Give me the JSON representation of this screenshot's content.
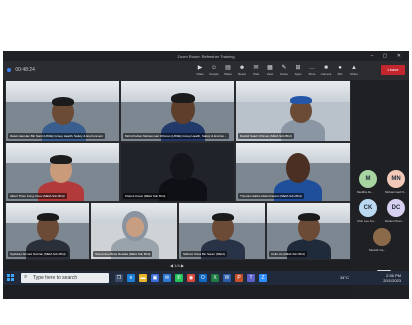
{
  "window": {
    "title": "Zoom Room: Refresher Training",
    "controls": "– ▢ ✕"
  },
  "toolbar": {
    "timer": "00:48:24",
    "items": [
      {
        "icon": "video-icon",
        "glyph": "▶",
        "label": "Video"
      },
      {
        "icon": "participants-icon",
        "glyph": "☺",
        "label": "People"
      },
      {
        "icon": "share-icon",
        "glyph": "▤",
        "label": "Share"
      },
      {
        "icon": "emoji-icon",
        "glyph": "☻",
        "label": "React"
      },
      {
        "icon": "chat-icon",
        "glyph": "✉",
        "label": "Chat"
      },
      {
        "icon": "grid-icon",
        "glyph": "▦",
        "label": "View"
      },
      {
        "icon": "whiteboard-icon",
        "glyph": "✎",
        "label": "Notes"
      },
      {
        "icon": "apps-icon",
        "glyph": "⊞",
        "label": "Apps"
      },
      {
        "icon": "more-icon",
        "glyph": "…",
        "label": "More"
      },
      {
        "icon": "camera-icon",
        "glyph": "■",
        "label": "Camera"
      },
      {
        "icon": "mic-icon",
        "glyph": "●",
        "label": "Mic"
      },
      {
        "icon": "share-screen-icon",
        "glyph": "▲",
        "label": "Share"
      }
    ],
    "leave_label": "Leave"
  },
  "tiles": [
    {
      "name": "Datuk Hamdan Bin Sanil (HSSE) Group Health, Safety & Environment"
    },
    {
      "name": "Mohd Faizan Muhammad Othman (HSSE) Group Health, Safety & Environ..."
    },
    {
      "name": "Rashid Saleh Othman (MEIA Sdn Bhd)"
    },
    {
      "name": "Albert Thien Fung Chow (MEIA Sdn Bhd)"
    },
    {
      "name": "Khairul Anuar (MEIA Sdn Bhd)"
    },
    {
      "name": "Thomas Hobbs Abdul Kassim (MEIA Sdn Bhd)"
    },
    {
      "name": "Syahiran Ahmad Norizan (MEIA Sdn Bhd)"
    },
    {
      "name": "Sheramine Binte Rosalia (MEIA Sdn Bhd)"
    },
    {
      "name": "Sidhuni Chua Bin Saran (MEIA)"
    },
    {
      "name": "Colin Ho (MEIA Sdn Bhd)"
    }
  ],
  "sidebar": {
    "participants": [
      {
        "initials": "M",
        "label": "Mediha Zu...",
        "color": "#a8d5a2"
      },
      {
        "initials": "MN",
        "label": "Mohammad N...",
        "color": "#f2c9b8"
      },
      {
        "initials": "CK",
        "label": "Chin Lee Ku...",
        "color": "#bcd9f2"
      },
      {
        "initials": "DC",
        "label": "Daniel Chan...",
        "color": "#d8d0f0"
      },
      {
        "initials": "",
        "label": "Muslah Ca..."
      }
    ]
  },
  "bottom_bar": {
    "pager": "◀ 1/4 ▶"
  },
  "taskbar": {
    "search_placeholder": "Type here to search",
    "weather": "34°C",
    "time": "2:36 PM",
    "date": "20/1/2023",
    "apps": [
      {
        "icon": "task-view-icon",
        "glyph": "❐",
        "color": "#3a4a66"
      },
      {
        "icon": "edge-icon",
        "glyph": "e",
        "color": "#1b7fd6"
      },
      {
        "icon": "file-explorer-icon",
        "glyph": "▬",
        "color": "#e8b52a"
      },
      {
        "icon": "store-icon",
        "glyph": "▣",
        "color": "#3b6bd6"
      },
      {
        "icon": "mail-icon",
        "glyph": "✉",
        "color": "#2d78d1"
      },
      {
        "icon": "whatsapp-icon",
        "glyph": "✆",
        "color": "#25c25a"
      },
      {
        "icon": "chrome-icon",
        "glyph": "◉",
        "color": "#d9473c"
      },
      {
        "icon": "outlook-icon",
        "glyph": "O",
        "color": "#1168c2"
      },
      {
        "icon": "excel-icon",
        "glyph": "X",
        "color": "#1d7a43"
      },
      {
        "icon": "word-icon",
        "glyph": "W",
        "color": "#2a5caa"
      },
      {
        "icon": "powerpoint-icon",
        "glyph": "P",
        "color": "#c4502b"
      },
      {
        "icon": "teams-icon",
        "glyph": "T",
        "color": "#5b5fc7"
      },
      {
        "icon": "zoom-icon",
        "glyph": "Z",
        "color": "#2d8cff"
      }
    ]
  }
}
